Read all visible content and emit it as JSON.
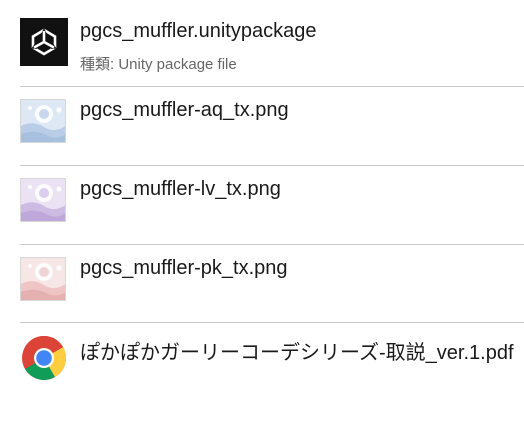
{
  "files": [
    {
      "name": "pgcs_muffler.unitypackage",
      "type_label": "種類: Unity package file",
      "icon": "unity-icon"
    },
    {
      "name": "pgcs_muffler-aq_tx.png",
      "icon": "image-thumbnail-icon",
      "tint": "#b9cde6"
    },
    {
      "name": "pgcs_muffler-lv_tx.png",
      "icon": "image-thumbnail-icon",
      "tint": "#cdbbe3"
    },
    {
      "name": "pgcs_muffler-pk_tx.png",
      "icon": "image-thumbnail-icon",
      "tint": "#eec4c4"
    },
    {
      "name": "ぽかぽかガーリーコーデシリーズ-取説_ver.1.pdf",
      "icon": "chrome-icon"
    }
  ],
  "colors": {
    "divider": "#c8c8c8",
    "text": "#1a1a1a",
    "secondary_text": "#666666"
  }
}
